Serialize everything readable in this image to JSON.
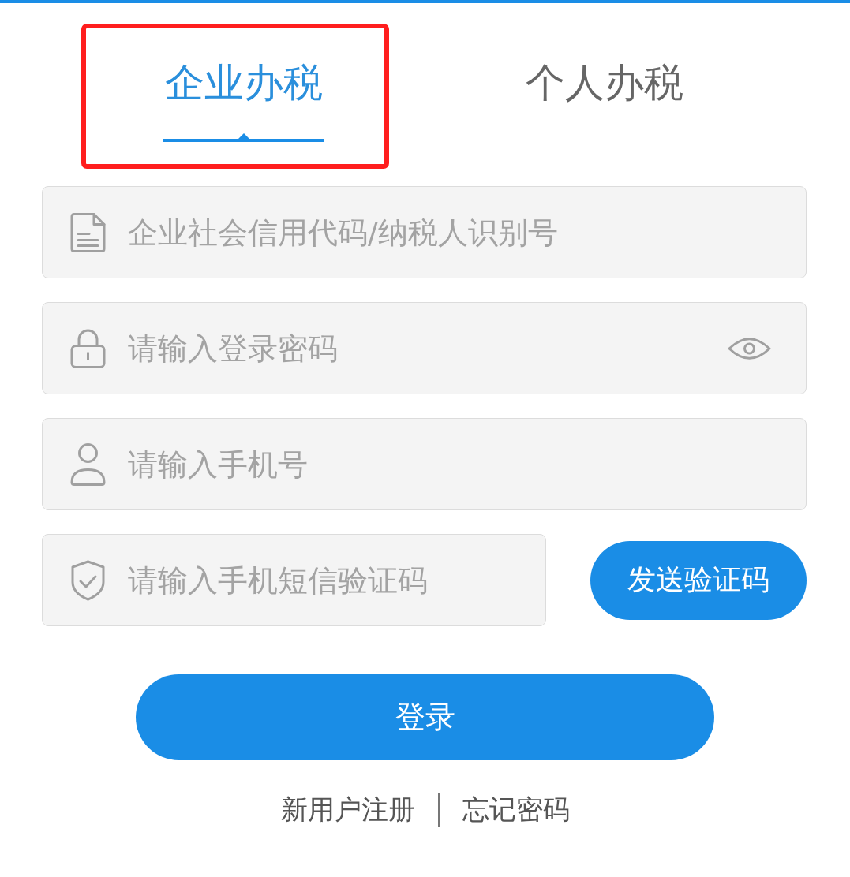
{
  "tabs": [
    {
      "label": "企业办税",
      "selected": true,
      "highlighted": true
    },
    {
      "label": "个人办税",
      "selected": false,
      "highlighted": false
    }
  ],
  "fields": [
    {
      "kind": "document",
      "placeholder": "企业社会信用代码/纳税人识别号"
    },
    {
      "kind": "password",
      "placeholder": "请输入登录密码"
    },
    {
      "kind": "phone",
      "placeholder": "请输入手机号"
    },
    {
      "kind": "sms_code",
      "placeholder": "请输入手机短信验证码",
      "button": "发送验证码"
    }
  ],
  "login_button": "登录",
  "links": [
    "新用户注册",
    "忘记密码"
  ]
}
